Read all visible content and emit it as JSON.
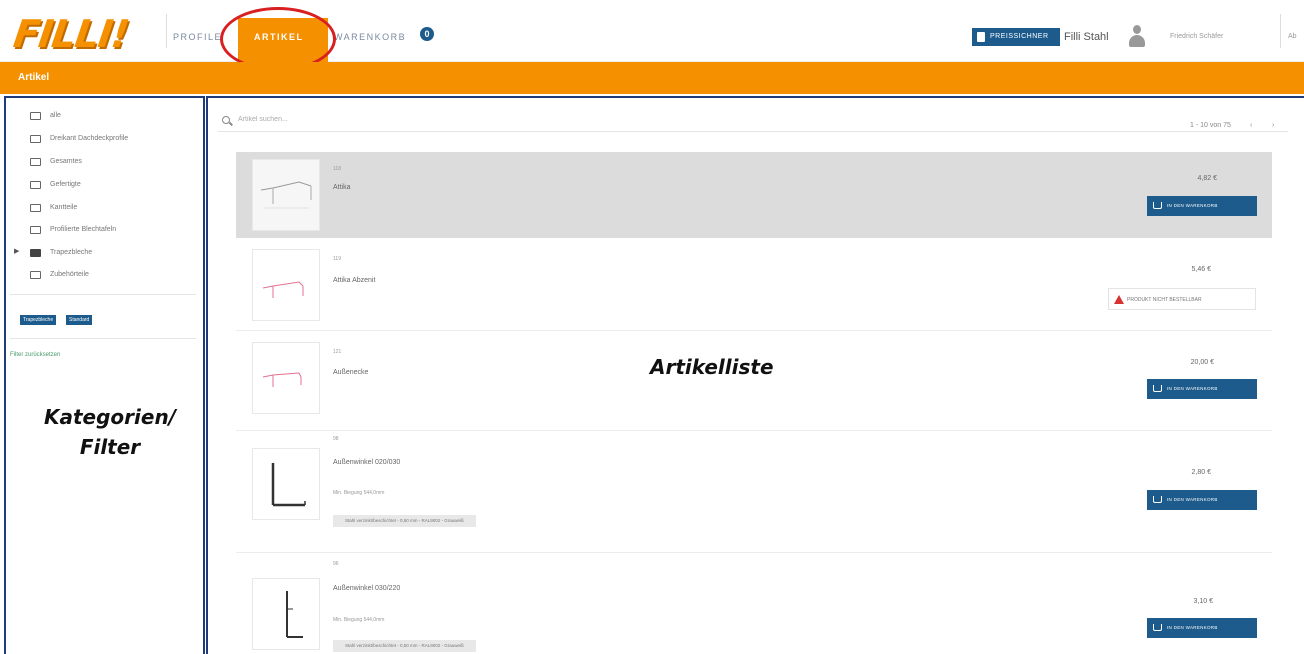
{
  "topbar": {
    "logo": "FILLI!",
    "nav": [
      {
        "label": "PROFILE"
      },
      {
        "label": "ARTIKEL"
      },
      {
        "label": "WARENKORB",
        "badge": "0"
      }
    ],
    "price_button_label": "PREISSICHNER",
    "user_name": "Filli Stahl",
    "user_sub": "Friedrich Schäfer",
    "more_label": "Ab"
  },
  "section": {
    "title": "Artikel"
  },
  "sidebar": {
    "categories": [
      {
        "label": "alle",
        "icon": "folder-icon"
      },
      {
        "label": "Dreikant Dachdeckprofile",
        "icon": "folder-icon"
      },
      {
        "label": "Gesamtes",
        "icon": "folder-icon"
      },
      {
        "label": "Gefertigte",
        "icon": "folder-icon"
      },
      {
        "label": "Kantteile",
        "icon": "folder-icon"
      },
      {
        "label": "Profilierte Blechtafeln",
        "icon": "folder-icon"
      },
      {
        "label": "Trapezbleche",
        "icon": "folder-filled-icon"
      },
      {
        "label": "Zubehörteile",
        "icon": "folder-icon"
      }
    ],
    "tags": [
      "Trapezbleche",
      "Standard"
    ],
    "reset_label": "Filter zurücksetzen"
  },
  "annotations": {
    "left_line1": "Kategorien/",
    "left_line2": "Filter",
    "main": "Artikelliste"
  },
  "list": {
    "search_placeholder": "Artikel suchen...",
    "pagination": "1 - 10 von 75",
    "prev": "‹",
    "next": "›",
    "items": [
      {
        "num": "118",
        "name": "Attika",
        "price": "4,82 €",
        "action": "IN DEN WARENKORB"
      },
      {
        "num": "119",
        "name": "Attika Abzenit",
        "price": "5,46 €",
        "action": "PRODUKT NICHT BESTELLBAR"
      },
      {
        "num": "121",
        "name": "Außenecke",
        "price": "20,00 €",
        "action": "IN DEN WARENKORB"
      },
      {
        "num": "98",
        "name": "Außenwinkel 020/030",
        "meta": "Min. Biegung 544,0mm",
        "note": "Stahl verzinkt/beschichtet - 0,50 mm - RAL9002 - Grauweiß",
        "price": "2,80 €",
        "action": "IN DEN WARENKORB"
      },
      {
        "num": "96",
        "name": "Außenwinkel 030/220",
        "meta": "Min. Biegung 544,0mm",
        "note": "Stahl verzinkt/beschichtet - 0,50 mm - RAL9002 - Grauweiß",
        "price": "3,10 €",
        "action": "IN DEN WARENKORB"
      }
    ]
  },
  "colors": {
    "accent": "#f59100",
    "primary": "#1c5b8c",
    "annotation_frame": "#1f3b7a",
    "highlight": "#d92020"
  }
}
